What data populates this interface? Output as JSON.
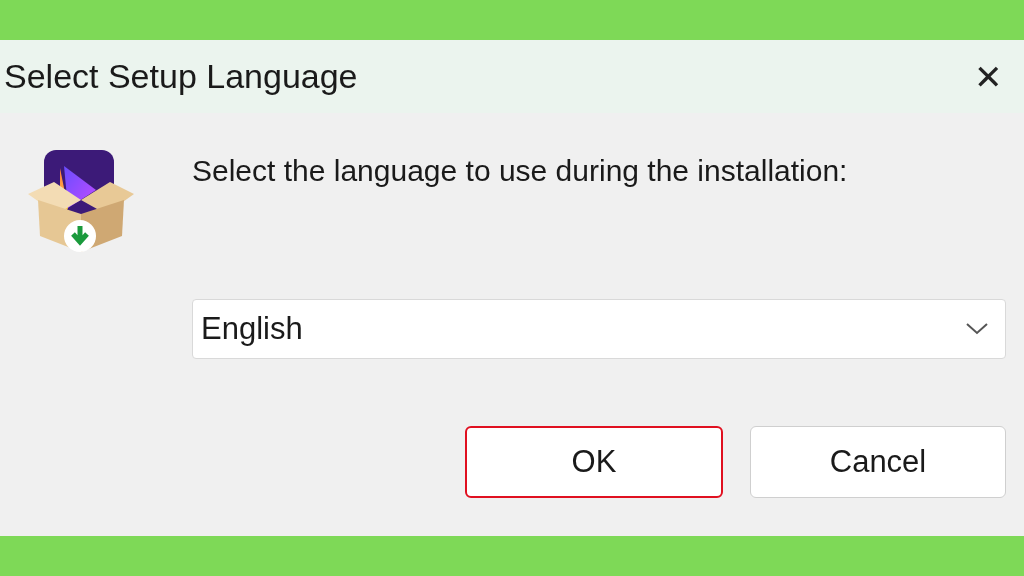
{
  "window": {
    "title": "Select Setup Language",
    "close": "✕"
  },
  "message": "Select the language to use during the installation:",
  "language_select": {
    "value": "English"
  },
  "buttons": [
    {
      "label": "OK",
      "highlighted": true
    },
    {
      "label": "Cancel",
      "highlighted": false
    }
  ]
}
